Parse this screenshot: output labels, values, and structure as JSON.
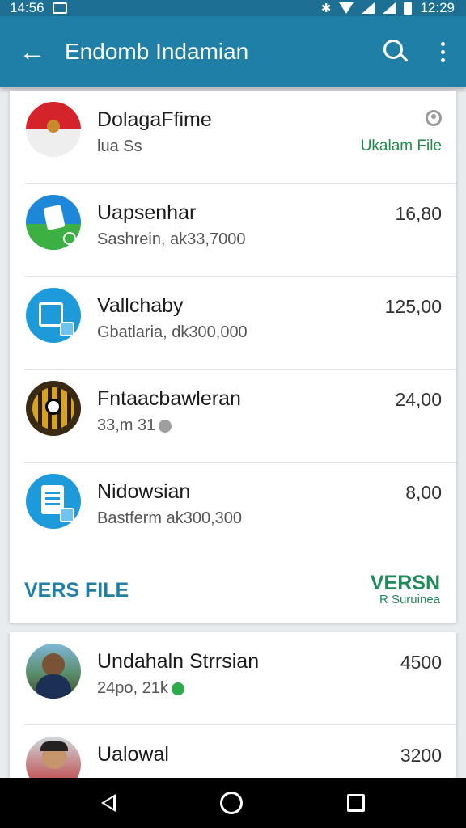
{
  "status_bar": {
    "time_left": "14:56",
    "time_right": "12:29",
    "icons": [
      "image-icon",
      "bluetooth-icon",
      "wifi-icon",
      "signal-icon",
      "battery-icon"
    ]
  },
  "app_bar": {
    "title": "Endomb Indamian",
    "icons": [
      "back-arrow-icon",
      "search-icon",
      "more-vert-icon"
    ]
  },
  "list": [
    {
      "name": "DolagaFfime",
      "subtitle": "lua Ss",
      "amount": "",
      "right_link": "Ukalam File",
      "avatar": "flag-avatar"
    },
    {
      "name": "Uapsenhar",
      "subtitle": "Sashrein, ak33,7000",
      "amount": "16,80",
      "avatar": "blue-document-avatar"
    },
    {
      "name": "Vallchaby",
      "subtitle": "Gbatlaria, dk300,000",
      "amount": "125,00",
      "avatar": "sky-document-avatar"
    },
    {
      "name": "Fntaacbawleran",
      "subtitle": "33,m 31",
      "amount": "24,00",
      "avatar": "gold-avatar"
    },
    {
      "name": "Nidowsian",
      "subtitle": "Bastferm ak300,300",
      "amount": "8,00",
      "avatar": "document-avatar"
    }
  ],
  "footer": {
    "left_label": "VERS FILE",
    "right_label": "VERSN",
    "right_sublabel": "R Suruinea"
  },
  "list2": [
    {
      "name": "Undahaln Strrsian",
      "subtitle": "24po, 21k",
      "amount": "4500",
      "avatar": "photo-avatar"
    },
    {
      "name": "Ualowal",
      "subtitle": "",
      "amount": "3200",
      "avatar": "photo-avatar"
    }
  ],
  "colors": {
    "app_bar": "#1f7fa7",
    "accent_green": "#1f8a4a",
    "dot_green": "#2faa4a"
  }
}
